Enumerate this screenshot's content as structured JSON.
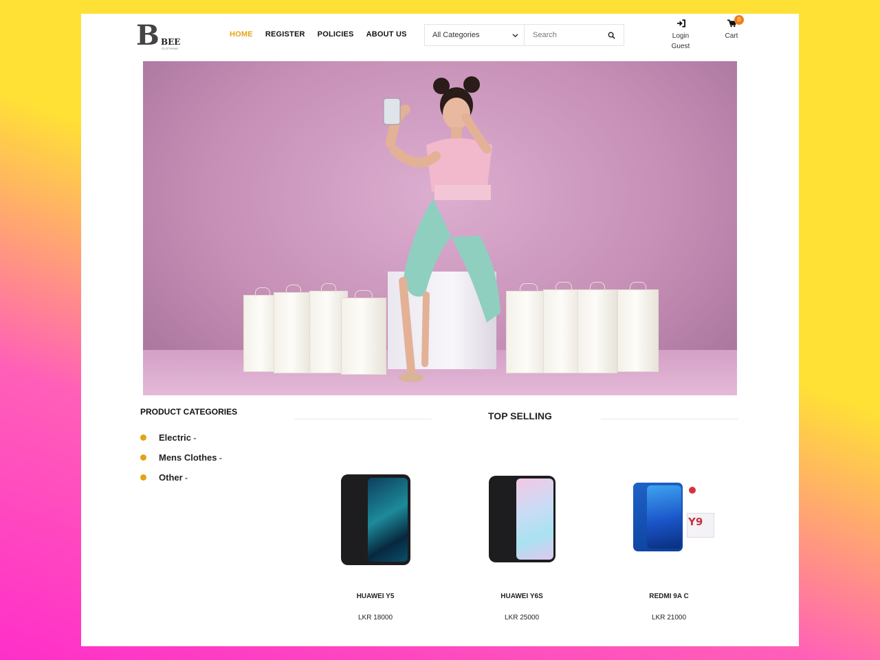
{
  "brand": {
    "initial": "B",
    "name": "BEE",
    "tagline": "CLOTHING"
  },
  "nav": [
    {
      "label": "HOME",
      "active": true
    },
    {
      "label": "REGISTER",
      "active": false
    },
    {
      "label": "POLICIES",
      "active": false
    },
    {
      "label": "ABOUT US",
      "active": false
    }
  ],
  "search": {
    "category_selected": "All Categories",
    "placeholder": "Search"
  },
  "user": {
    "login_label": "Login",
    "user_name": "Guest"
  },
  "cart": {
    "label": "Cart",
    "count": "0"
  },
  "sidebar": {
    "title": "PRODUCT CATEGORIES",
    "items": [
      {
        "label": "Electric"
      },
      {
        "label": "Mens Clothes"
      },
      {
        "label": "Other"
      }
    ]
  },
  "top_selling": {
    "title": "TOP SELLING",
    "products": [
      {
        "name": "HUAWEI Y5",
        "price": "LKR 18000"
      },
      {
        "name": "HUAWEI Y6S",
        "price": "LKR 25000"
      },
      {
        "name": "REDMI 9A C",
        "price": "LKR 21000"
      }
    ]
  },
  "colors": {
    "accent": "#e8a317",
    "badge": "#f07f1a",
    "dot": "#e0a414"
  }
}
